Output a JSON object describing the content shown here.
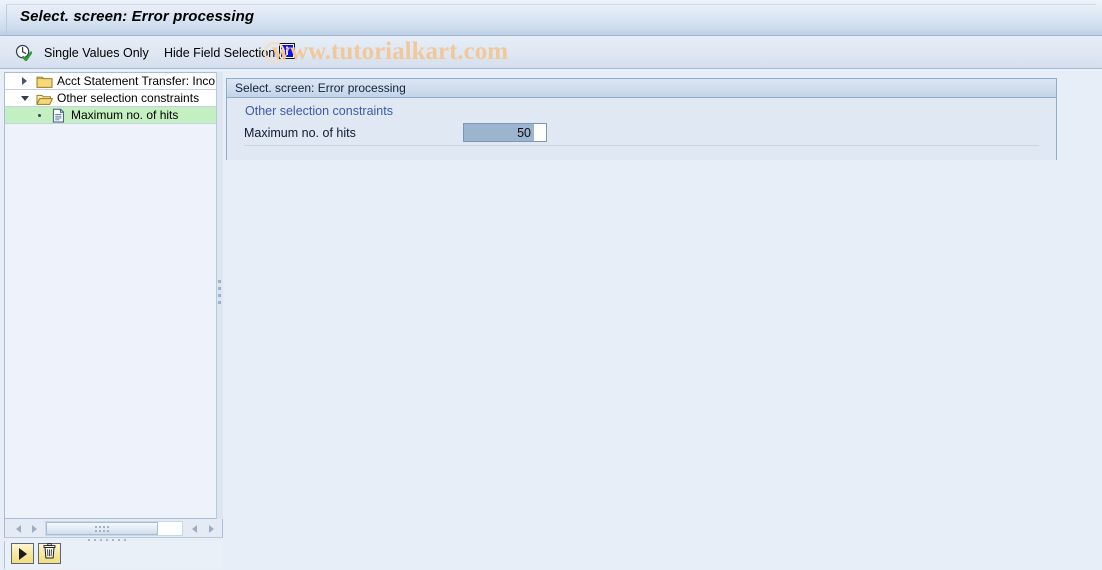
{
  "window": {
    "title": "Select. screen: Error processing"
  },
  "toolbar": {
    "variant_icon": "clock-check-icon",
    "single_values_label": "Single Values Only",
    "hide_field_selection_label": "Hide Field Selection",
    "info_icon": "information-icon"
  },
  "watermark": {
    "text": "www.tutorialkart.com",
    "color": "#f2c79a"
  },
  "tree": {
    "items": [
      {
        "label": "Acct Statement Transfer: Inco",
        "icon": "folder-closed-icon",
        "twisty": "collapsed",
        "level": 0,
        "selected": false
      },
      {
        "label": "Other selection constraints",
        "icon": "folder-open-icon",
        "twisty": "expanded",
        "level": 0,
        "selected": false
      },
      {
        "label": "Maximum no. of hits",
        "icon": "document-icon",
        "twisty": "none",
        "level": 1,
        "selected": true
      }
    ],
    "selection_color": "#c4efc1"
  },
  "tree_scrollbar": {
    "left_arrow_1": "triangle-left-icon",
    "left_arrow_2": "triangle-right-icon",
    "right_arrow_1": "triangle-left-icon",
    "right_arrow_2": "triangle-right-icon"
  },
  "tree_actions": {
    "execute_icon": "triangle-right-icon",
    "delete_icon": "trash-can-icon"
  },
  "content": {
    "panel_header": "Select. screen: Error processing",
    "group_title": "Other selection constraints",
    "field": {
      "label": "Maximum no. of hits",
      "value": "50",
      "placeholder": ""
    }
  },
  "colors": {
    "accent_blue": "#3b5ba7",
    "panel_border": "#8facc8",
    "background": "#e8eef7",
    "button_yellow": "#f6e79a"
  }
}
